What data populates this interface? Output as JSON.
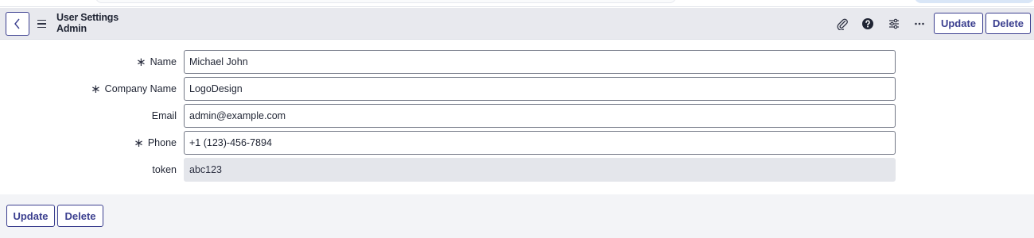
{
  "header": {
    "title": "User Settings",
    "subtitle": "Admin",
    "icons": [
      "back-icon",
      "menu-icon",
      "attachment-icon",
      "help-icon",
      "settings-sliders-icon",
      "more-icon"
    ],
    "update_label": "Update",
    "delete_label": "Delete"
  },
  "form": {
    "fields": [
      {
        "label": "Name",
        "required": true,
        "value": "Michael John"
      },
      {
        "label": "Company Name",
        "required": true,
        "value": "LogoDesign"
      },
      {
        "label": "Email",
        "required": false,
        "value": "admin@example.com"
      },
      {
        "label": "Phone",
        "required": true,
        "value": "+1 (123)-456-7894"
      },
      {
        "label": "token",
        "required": false,
        "value": "abc123",
        "readonly": true
      }
    ]
  },
  "footer": {
    "update_label": "Update",
    "delete_label": "Delete"
  },
  "colors": {
    "accent": "#3b3f8f",
    "header_bg": "#e8e9ee",
    "readonly_bg": "#e4e6eb",
    "footer_bg": "#f3f4f7"
  }
}
